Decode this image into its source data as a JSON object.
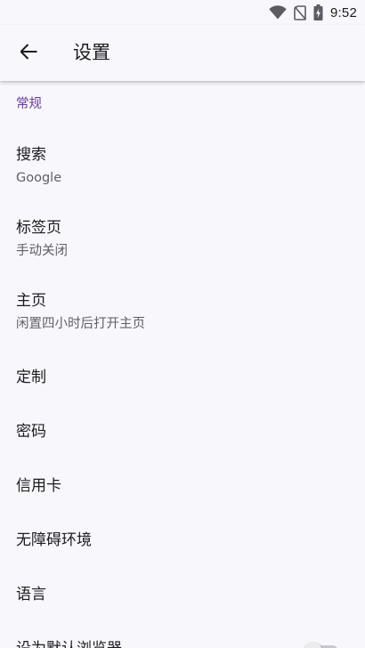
{
  "status_bar": {
    "time": "9:52",
    "icons": [
      "wifi-icon",
      "no-sim-icon",
      "battery-charging-icon"
    ]
  },
  "app_bar": {
    "back_icon": "arrow-left-icon",
    "title": "设置"
  },
  "accent_color": "#6a3aa2",
  "section": {
    "header": "常规"
  },
  "settings": [
    {
      "title": "搜索",
      "summary": "Google"
    },
    {
      "title": "标签页",
      "summary": "手动关闭"
    },
    {
      "title": "主页",
      "summary": "闲置四小时后打开主页"
    },
    {
      "title": "定制"
    },
    {
      "title": "密码"
    },
    {
      "title": "信用卡"
    },
    {
      "title": "无障碍环境"
    },
    {
      "title": "语言"
    },
    {
      "title": "设为默认浏览器",
      "switch_on": false
    }
  ]
}
